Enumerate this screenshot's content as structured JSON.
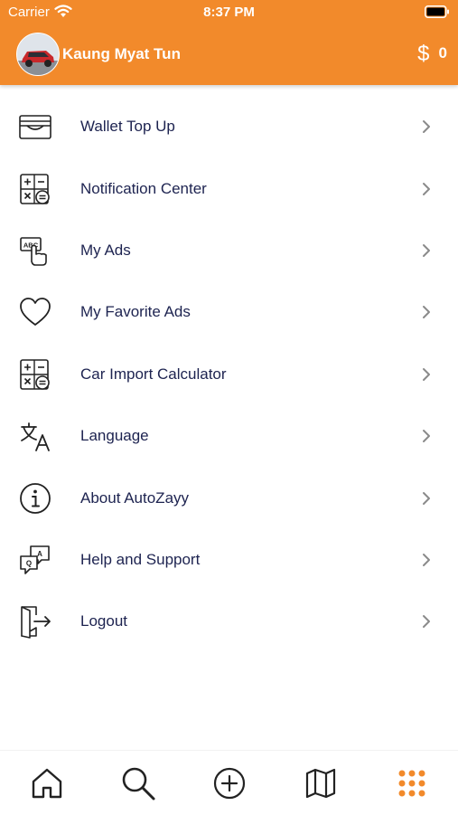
{
  "status_bar": {
    "carrier": "Carrier",
    "time": "8:37 PM"
  },
  "profile": {
    "name": "Kaung Myat Tun",
    "currency_symbol": "$",
    "balance": "0"
  },
  "menu": {
    "items": [
      {
        "label": "Wallet Top Up",
        "icon": "wallet-icon"
      },
      {
        "label": "Notification Center",
        "icon": "calculator-icon"
      },
      {
        "label": "My Ads",
        "icon": "ads-touch-icon"
      },
      {
        "label": "My Favorite Ads",
        "icon": "heart-icon"
      },
      {
        "label": "Car Import Calculator",
        "icon": "calculator-icon"
      },
      {
        "label": "Language",
        "icon": "translate-icon"
      },
      {
        "label": "About AutoZayy",
        "icon": "info-icon"
      },
      {
        "label": "Help and Support",
        "icon": "qa-chat-icon"
      },
      {
        "label": "Logout",
        "icon": "logout-icon"
      }
    ]
  },
  "tabbar": {
    "tabs": [
      {
        "icon": "home-icon"
      },
      {
        "icon": "search-icon"
      },
      {
        "icon": "add-circle-icon"
      },
      {
        "icon": "map-icon"
      },
      {
        "icon": "grid-menu-icon",
        "active": true
      }
    ]
  },
  "colors": {
    "accent": "#f28a2b",
    "text": "#1d2350",
    "icon": "#222222"
  }
}
